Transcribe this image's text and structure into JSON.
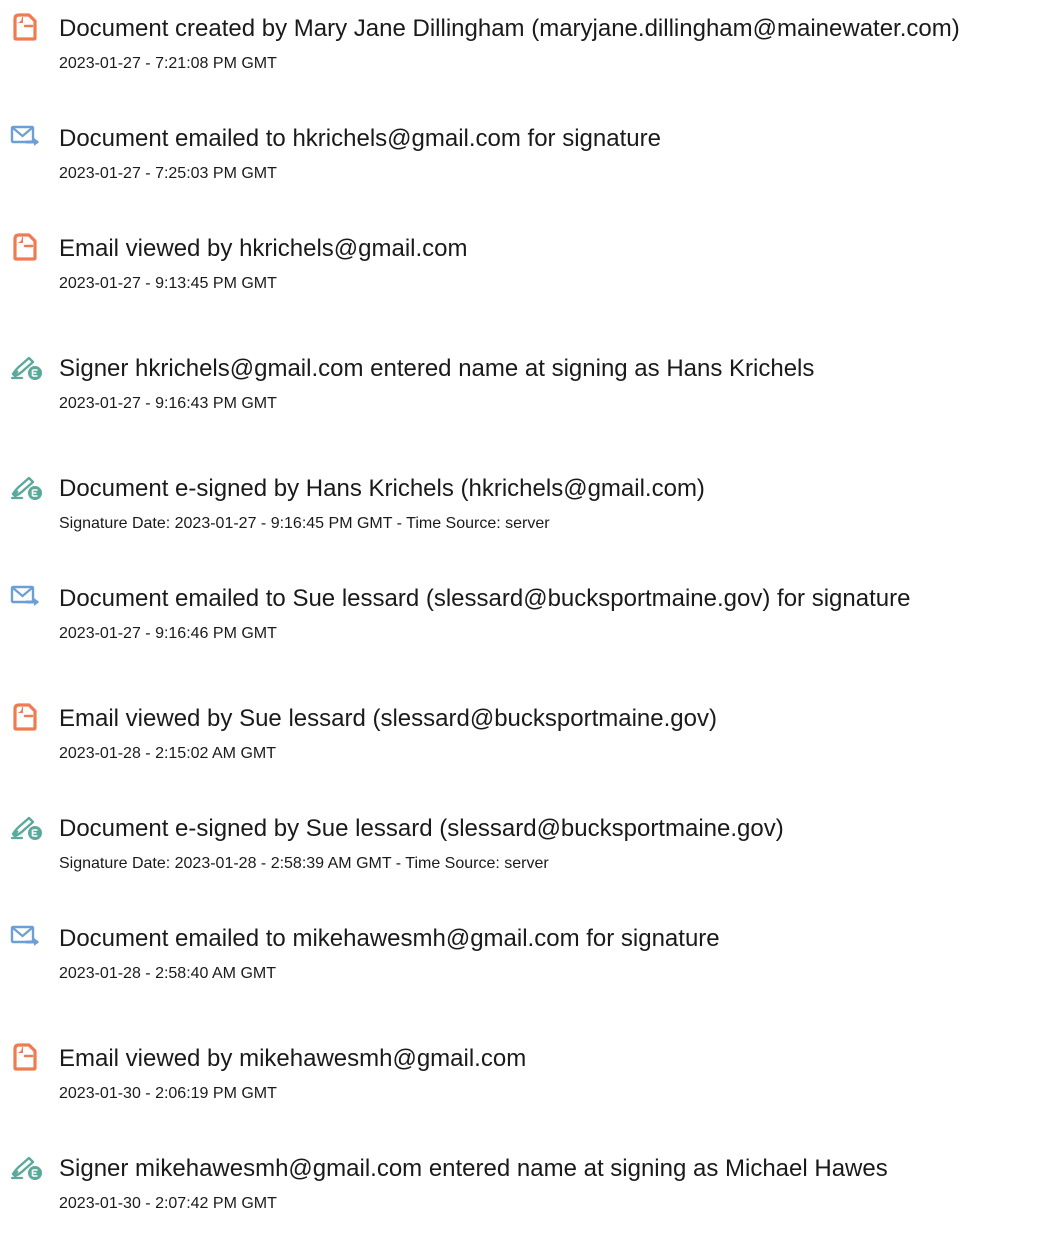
{
  "events": [
    {
      "icon": "document-created-icon",
      "title": "Document created by Mary Jane Dillingham (maryjane.dillingham@mainewater.com)",
      "meta": "2023-01-27 - 7:21:08 PM GMT"
    },
    {
      "icon": "email-sent-icon",
      "title": "Document emailed to hkrichels@gmail.com for signature",
      "meta": "2023-01-27 - 7:25:03 PM GMT"
    },
    {
      "icon": "email-viewed-icon",
      "title": "Email viewed by hkrichels@gmail.com",
      "meta": "2023-01-27 - 9:13:45 PM GMT"
    },
    {
      "icon": "signature-pen-icon",
      "title": "Signer hkrichels@gmail.com entered name at signing as Hans Krichels",
      "meta": "2023-01-27 - 9:16:43 PM GMT"
    },
    {
      "icon": "signature-pen-icon",
      "title": "Document e-signed by Hans Krichels (hkrichels@gmail.com)",
      "meta": "Signature Date: 2023-01-27 - 9:16:45 PM GMT - Time Source: server"
    },
    {
      "icon": "email-sent-icon",
      "title": "Document emailed to Sue lessard (slessard@bucksportmaine.gov) for signature",
      "meta": "2023-01-27 - 9:16:46 PM GMT"
    },
    {
      "icon": "email-viewed-icon",
      "title": "Email viewed by Sue lessard (slessard@bucksportmaine.gov)",
      "meta": "2023-01-28 - 2:15:02 AM GMT"
    },
    {
      "icon": "signature-pen-icon",
      "title": "Document e-signed by Sue lessard (slessard@bucksportmaine.gov)",
      "meta": "Signature Date: 2023-01-28 - 2:58:39 AM GMT - Time Source: server"
    },
    {
      "icon": "email-sent-icon",
      "title": "Document emailed to mikehawesmh@gmail.com for signature",
      "meta": "2023-01-28 - 2:58:40 AM GMT"
    },
    {
      "icon": "email-viewed-icon",
      "title": "Email viewed by mikehawesmh@gmail.com",
      "meta": "2023-01-30 - 2:06:19 PM GMT"
    },
    {
      "icon": "signature-pen-icon",
      "title": "Signer mikehawesmh@gmail.com entered name at signing as Michael Hawes",
      "meta": "2023-01-30 - 2:07:42 PM GMT"
    }
  ],
  "colors": {
    "document_icon": "#ee7b52",
    "email_icon": "#6b9fd6",
    "pen_icon": "#5aa99b",
    "text": "#1a1a1a"
  }
}
